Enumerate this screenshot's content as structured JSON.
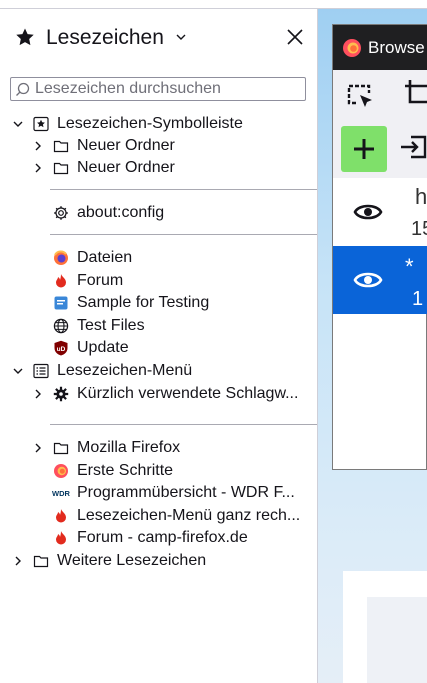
{
  "sidebar": {
    "title": "Lesezeichen",
    "search_placeholder": "Lesezeichen durchsuchen",
    "items": [
      {
        "label": "Lesezeichen-Symbolleiste"
      },
      {
        "label": "Neuer Ordner"
      },
      {
        "label": "Neuer Ordner"
      },
      {
        "label": "about:config"
      },
      {
        "label": "Dateien"
      },
      {
        "label": "Forum"
      },
      {
        "label": "Sample for Testing"
      },
      {
        "label": "Test Files"
      },
      {
        "label": "Update"
      },
      {
        "label": "Lesezeichen-Menü"
      },
      {
        "label": "Kürzlich verwendete Schlagw..."
      },
      {
        "label": "Mozilla Firefox"
      },
      {
        "label": "Erste Schritte"
      },
      {
        "label": "Programmübersicht - WDR F..."
      },
      {
        "label": "Lesezeichen-Menü ganz rech..."
      },
      {
        "label": "Forum - camp-firefox.de"
      },
      {
        "label": "Weitere Lesezeichen"
      }
    ]
  },
  "popup": {
    "title": "Browse",
    "items": [
      {
        "line1": "h",
        "line2": "15"
      },
      {
        "line1": "* ",
        "line2": "1"
      }
    ]
  },
  "icons": {
    "wdr": "WDR",
    "ublock": "uD"
  },
  "colors": {
    "accent": "#0a64d8",
    "add": "#7fe06a",
    "titlebar": "#1f1f21"
  }
}
